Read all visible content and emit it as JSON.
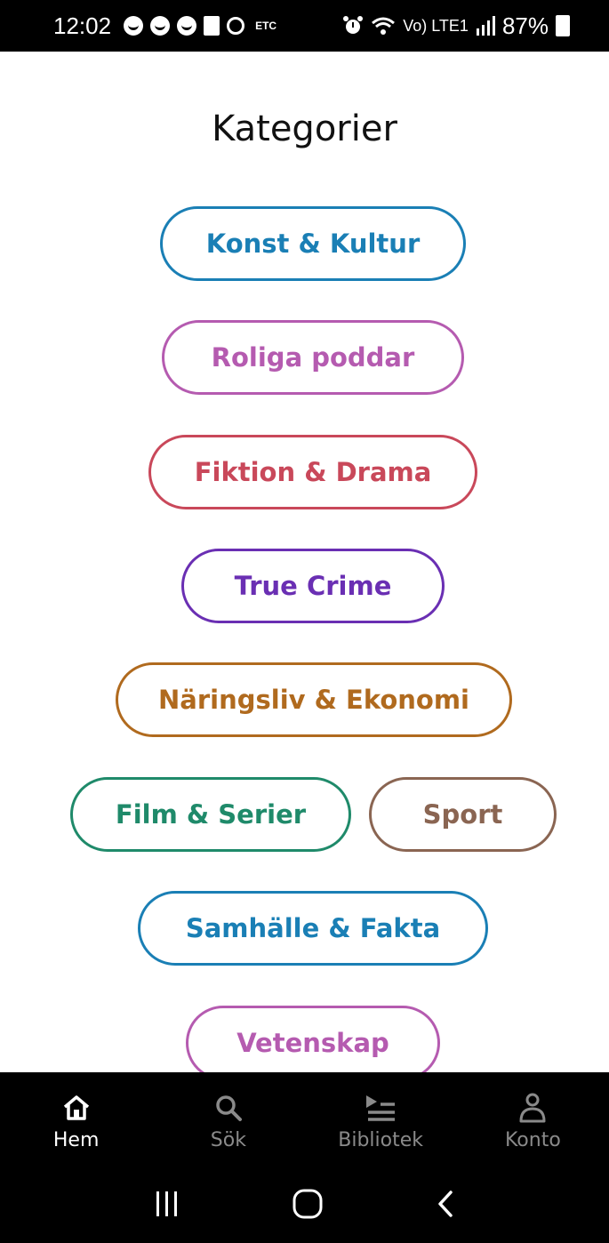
{
  "status_bar": {
    "time": "12:02",
    "carrier_tag": "ETC",
    "network": "Vo) LTE1",
    "battery": "87%"
  },
  "page": {
    "title": "Kategorier"
  },
  "categories": [
    {
      "label": "Konst & Kultur",
      "color": "#1a7fb5"
    },
    {
      "label": "Roliga poddar",
      "color": "#b55bb0"
    },
    {
      "label": "Fiktion & Drama",
      "color": "#c9485a"
    },
    {
      "label": "True Crime",
      "color": "#6a2fb3"
    },
    {
      "label": "Näringsliv & Ekonomi",
      "color": "#b06a1e"
    },
    {
      "label": "Film & Serier",
      "color": "#1f8a6a"
    },
    {
      "label": "Sport",
      "color": "#8a6552"
    },
    {
      "label": "Samhälle & Fakta",
      "color": "#1a7fb5"
    },
    {
      "label": "Vetenskap",
      "color": "#b55bb0"
    }
  ],
  "bottom_nav": {
    "items": [
      {
        "label": "Hem",
        "icon": "home-icon",
        "active": true
      },
      {
        "label": "Sök",
        "icon": "search-icon",
        "active": false
      },
      {
        "label": "Bibliotek",
        "icon": "library-icon",
        "active": false
      },
      {
        "label": "Konto",
        "icon": "account-icon",
        "active": false
      }
    ]
  },
  "system_nav": {
    "icons": [
      "recent-apps-icon",
      "home-circle-icon",
      "back-icon"
    ]
  }
}
